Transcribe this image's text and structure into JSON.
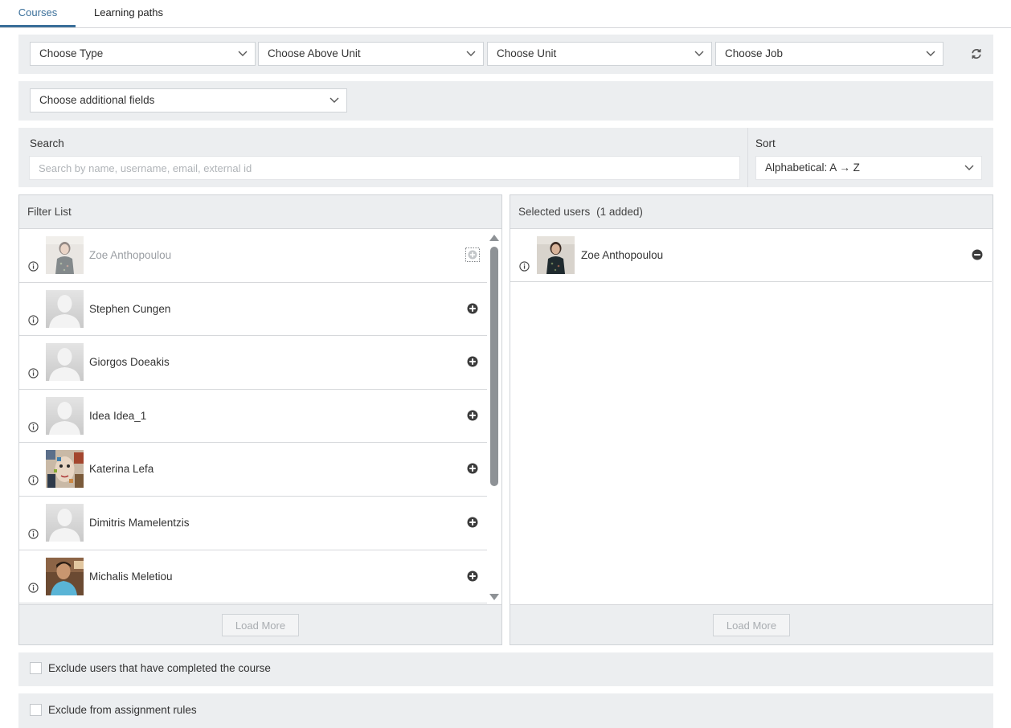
{
  "tabs": [
    {
      "label": "Courses",
      "active": true
    },
    {
      "label": "Learning paths",
      "active": false
    }
  ],
  "filters": {
    "type": "Choose Type",
    "above_unit": "Choose Above Unit",
    "unit": "Choose Unit",
    "job": "Choose Job",
    "refresh_icon": "refresh-icon",
    "additional_fields": "Choose additional fields"
  },
  "search": {
    "label": "Search",
    "placeholder": "Search by name, username, email, external id",
    "value": ""
  },
  "sort": {
    "label": "Sort",
    "selected": "Alphabetical: A → Z"
  },
  "filter_list": {
    "title": "Filter List",
    "load_more": "Load More",
    "users": [
      {
        "name": "Zoe Anthopoulou",
        "avatar": "photo-woman",
        "disabled": true
      },
      {
        "name": "Stephen Cungen",
        "avatar": "default",
        "disabled": false
      },
      {
        "name": "Giorgos Doeakis",
        "avatar": "default",
        "disabled": false
      },
      {
        "name": "Idea Idea_1",
        "avatar": "default",
        "disabled": false
      },
      {
        "name": "Katerina Lefa",
        "avatar": "photo-art",
        "disabled": false
      },
      {
        "name": "Dimitris Mamelentzis",
        "avatar": "default",
        "disabled": false
      },
      {
        "name": "Michalis Meletiou",
        "avatar": "photo-man",
        "disabled": false
      }
    ]
  },
  "selected_users": {
    "title": "Selected users",
    "count_text": "(1 added)",
    "load_more": "Load More",
    "users": [
      {
        "name": "Zoe Anthopoulou",
        "avatar": "photo-woman"
      }
    ]
  },
  "options": {
    "exclude_completed": {
      "label": "Exclude users that have completed the course",
      "checked": false
    },
    "exclude_rules": {
      "label": "Exclude from assignment rules",
      "checked": false
    }
  },
  "colors": {
    "accent": "#3a6f9a",
    "panel_bg": "#eceef0",
    "border": "#cfd3d7"
  }
}
